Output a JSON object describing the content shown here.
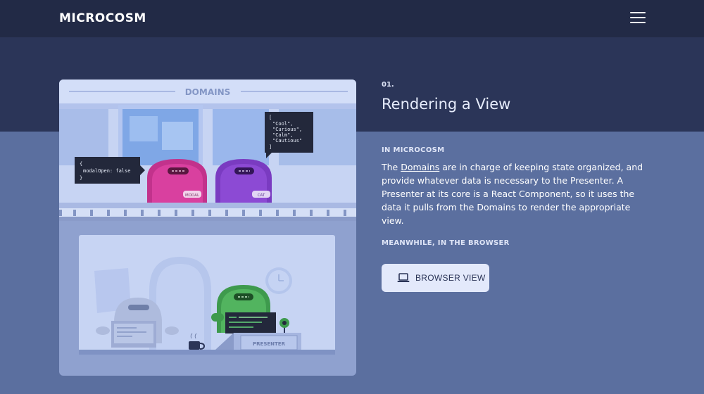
{
  "nav": {
    "logo": "MICROCOSM"
  },
  "illustration": {
    "domains_label": "DOMAINS",
    "code_left": "{\n  modalOpen: false\n}",
    "code_right": "[\n  \"Cool\",\n  \"Curious\",\n  \"Calm\",\n  \"Cautious\"\n]",
    "robot_modal_tag": "MODAL",
    "robot_cat_tag": "CAT",
    "presenter_label": "PRESENTER"
  },
  "section": {
    "step": "01.",
    "title": "Rendering a View",
    "in_label": "IN MICROCOSM",
    "para_before": "The ",
    "para_link": "Domains",
    "para_after": " are in charge of keeping state organized, and provide whatever data is necessary to the Presenter. A Presenter at its core is a React Component, so it uses the data it pulls from the Domains to render the appropriate view.",
    "meanwhile_label": "MEANWHILE, IN THE BROWSER",
    "button_label": "BROWSER VIEW"
  },
  "colors": {
    "nav_bg": "#222a46",
    "band_bg": "#2b3558",
    "page_bg": "#5b6f9f",
    "button_bg": "#e3e9fb"
  },
  "icons": {
    "menu": "hamburger-icon",
    "button": "laptop-icon"
  }
}
